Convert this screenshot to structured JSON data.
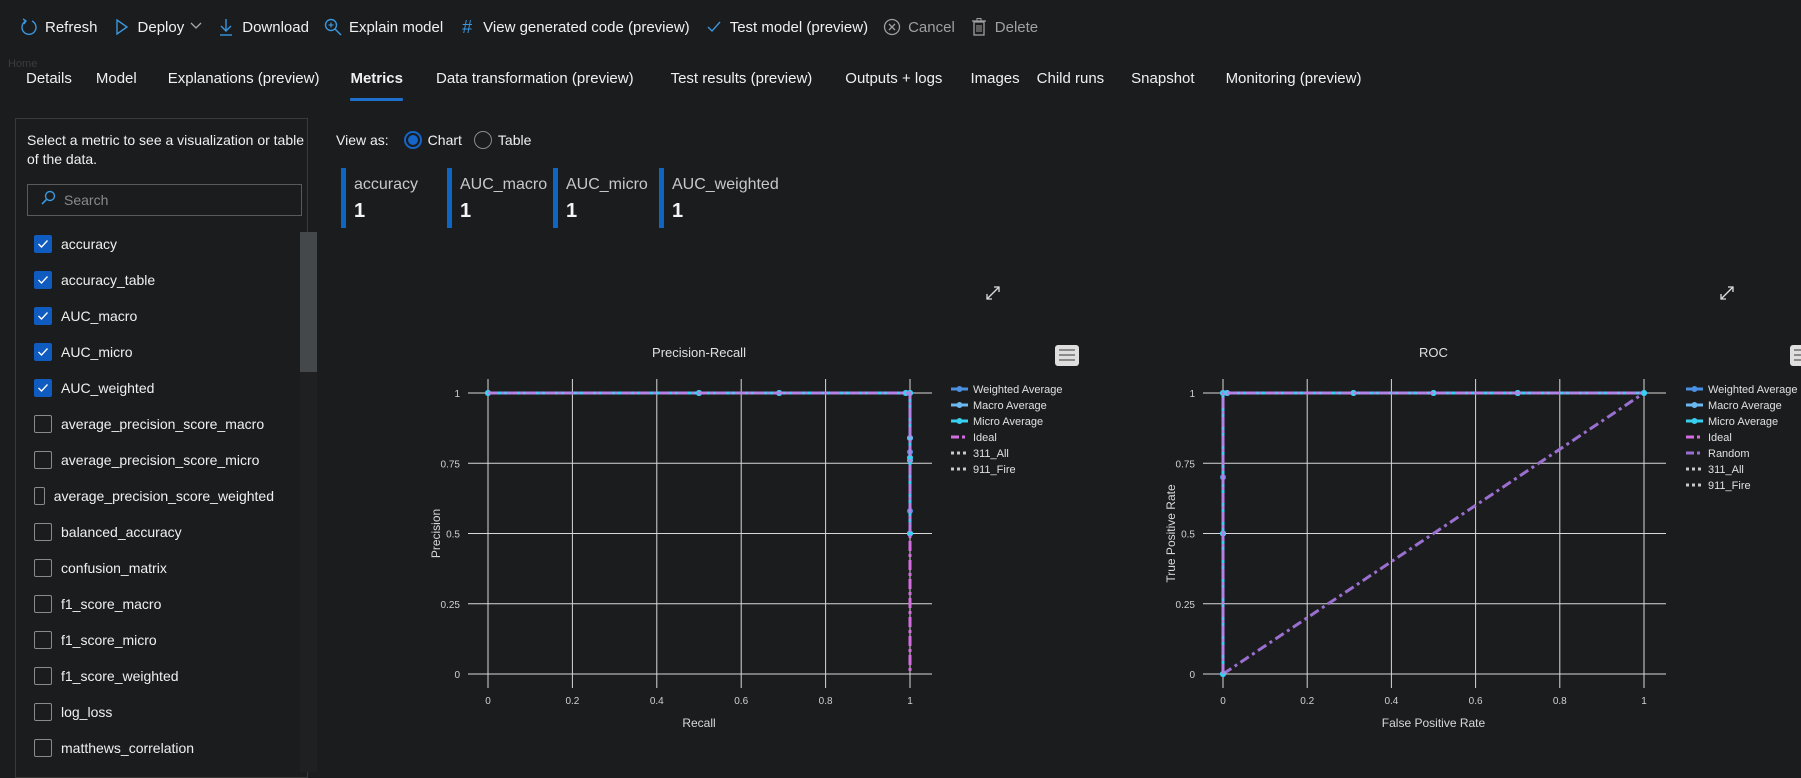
{
  "toolbar": [
    {
      "label": "Refresh",
      "icon": "refresh-icon",
      "disabled": false
    },
    {
      "label": "Deploy",
      "icon": "deploy-icon",
      "disabled": false,
      "dropdown": true
    },
    {
      "label": "Download",
      "icon": "download-icon",
      "disabled": false
    },
    {
      "label": "Explain model",
      "icon": "explain-icon",
      "disabled": false
    },
    {
      "label": "View generated code (preview)",
      "icon": "hash-icon",
      "disabled": false
    },
    {
      "label": "Test model (preview)",
      "icon": "check-icon",
      "disabled": false
    },
    {
      "label": "Cancel",
      "icon": "cancel-icon",
      "disabled": true
    },
    {
      "label": "Delete",
      "icon": "delete-icon",
      "disabled": true
    }
  ],
  "breadcrumb": "Home",
  "tabs": [
    {
      "label": "Details",
      "active": false
    },
    {
      "label": "Model",
      "active": false
    },
    {
      "label": "Explanations (preview)",
      "active": false
    },
    {
      "label": "Metrics",
      "active": true
    },
    {
      "label": "Data transformation (preview)",
      "active": false
    },
    {
      "label": "Test results (preview)",
      "active": false
    },
    {
      "label": "Outputs + logs",
      "active": false
    },
    {
      "label": "Images",
      "active": false
    },
    {
      "label": "Child runs",
      "active": false
    },
    {
      "label": "Snapshot",
      "active": false
    },
    {
      "label": "Monitoring (preview)",
      "active": false
    }
  ],
  "left_panel": {
    "description": "Select a metric to see a visualization or table of the data.",
    "search_placeholder": "Search",
    "metrics": [
      {
        "label": "accuracy",
        "checked": true
      },
      {
        "label": "accuracy_table",
        "checked": true
      },
      {
        "label": "AUC_macro",
        "checked": true
      },
      {
        "label": "AUC_micro",
        "checked": true
      },
      {
        "label": "AUC_weighted",
        "checked": true
      },
      {
        "label": "average_precision_score_macro",
        "checked": false
      },
      {
        "label": "average_precision_score_micro",
        "checked": false
      },
      {
        "label": "average_precision_score_weighted",
        "checked": false
      },
      {
        "label": "balanced_accuracy",
        "checked": false
      },
      {
        "label": "confusion_matrix",
        "checked": false
      },
      {
        "label": "f1_score_macro",
        "checked": false
      },
      {
        "label": "f1_score_micro",
        "checked": false
      },
      {
        "label": "f1_score_weighted",
        "checked": false
      },
      {
        "label": "log_loss",
        "checked": false
      },
      {
        "label": "matthews_correlation",
        "checked": false
      }
    ]
  },
  "view_as": {
    "label": "View as:",
    "options": [
      {
        "label": "Chart",
        "selected": true
      },
      {
        "label": "Table",
        "selected": false
      }
    ]
  },
  "metric_cards": [
    {
      "name": "accuracy",
      "value": "1"
    },
    {
      "name": "AUC_macro",
      "value": "1"
    },
    {
      "name": "AUC_micro",
      "value": "1"
    },
    {
      "name": "AUC_weighted",
      "value": "1"
    }
  ],
  "colors": {
    "accent": "#1f6fcc",
    "weighted_average": "#4a90e2",
    "macro_average": "#6cb8f0",
    "micro_average": "#38d0f0",
    "ideal": "#d36ee0",
    "random": "#9b6fd0",
    "class_series": "#c8c8c8"
  },
  "chart_data": [
    {
      "type": "line",
      "title": "Precision-Recall",
      "xlabel": "Recall",
      "ylabel": "Precision",
      "xlim": [
        0,
        1
      ],
      "ylim": [
        0,
        1
      ],
      "xticks": [
        "0",
        "0.2",
        "0.4",
        "0.6",
        "0.8",
        "1"
      ],
      "yticks": [
        "0",
        "0.25",
        "0.5",
        "0.75",
        "1"
      ],
      "grid": true,
      "legend_position": "right",
      "series": [
        {
          "name": "Weighted Average",
          "x": [
            0,
            0.5,
            0.69,
            0.99,
            1,
            1,
            1,
            1,
            1
          ],
          "y": [
            1,
            1,
            1,
            1,
            1,
            0.84,
            0.79,
            0.58,
            0.5
          ]
        },
        {
          "name": "Macro Average",
          "x": [
            0,
            0.5,
            0.69,
            0.99,
            1,
            1,
            1,
            1
          ],
          "y": [
            1,
            1,
            1,
            1,
            1,
            0.84,
            0.76,
            0.5
          ]
        },
        {
          "name": "Micro Average",
          "x": [
            0,
            0.5,
            0.69,
            0.99,
            1,
            1,
            1
          ],
          "y": [
            1,
            1,
            1,
            1,
            1,
            0.77,
            0.5
          ]
        },
        {
          "name": "Ideal",
          "x": [
            0,
            1,
            1
          ],
          "y": [
            1,
            1,
            0
          ]
        },
        {
          "name": "311_All",
          "x": [],
          "y": []
        },
        {
          "name": "911_Fire",
          "x": [],
          "y": []
        }
      ]
    },
    {
      "type": "line",
      "title": "ROC",
      "xlabel": "False Positive Rate",
      "ylabel": "True Positive Rate",
      "xlim": [
        0,
        1
      ],
      "ylim": [
        0,
        1
      ],
      "xticks": [
        "0",
        "0.2",
        "0.4",
        "0.6",
        "0.8",
        "1"
      ],
      "yticks": [
        "0",
        "0.25",
        "0.5",
        "0.75",
        "1"
      ],
      "grid": true,
      "legend_position": "right",
      "series": [
        {
          "name": "Weighted Average",
          "x": [
            0,
            0,
            0,
            0,
            0.01,
            0.31,
            0.5,
            0.7,
            1
          ],
          "y": [
            0,
            0.5,
            0.7,
            1,
            1,
            1,
            1,
            1,
            1
          ]
        },
        {
          "name": "Macro Average",
          "x": [
            0,
            0,
            0,
            0.01,
            0.31,
            0.5,
            0.7,
            1
          ],
          "y": [
            0,
            0.5,
            1,
            1,
            1,
            1,
            1,
            1
          ]
        },
        {
          "name": "Micro Average",
          "x": [
            0,
            0,
            0,
            0.31,
            0.5,
            0.7,
            1
          ],
          "y": [
            0,
            0.5,
            1,
            1,
            1,
            1,
            1
          ]
        },
        {
          "name": "Ideal",
          "x": [
            0,
            0,
            1
          ],
          "y": [
            0,
            1,
            1
          ]
        },
        {
          "name": "Random",
          "x": [
            0,
            1
          ],
          "y": [
            0,
            1
          ]
        },
        {
          "name": "311_All",
          "x": [],
          "y": []
        },
        {
          "name": "911_Fire",
          "x": [],
          "y": []
        }
      ]
    }
  ]
}
